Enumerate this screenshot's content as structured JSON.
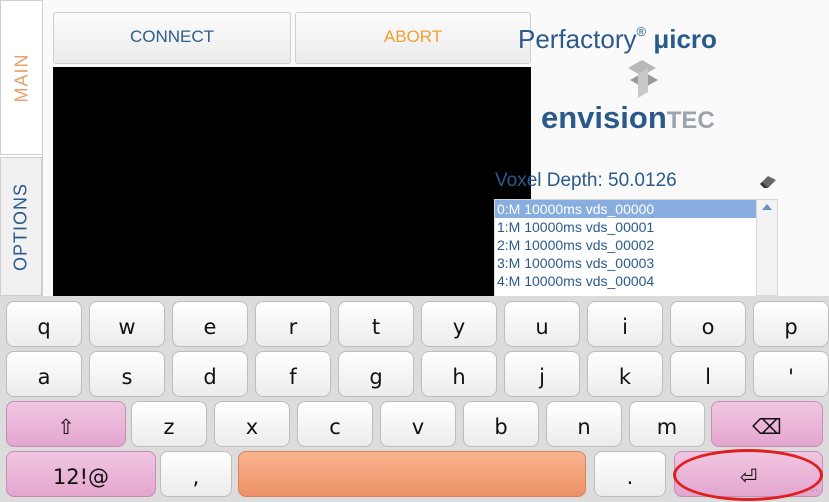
{
  "tabs": {
    "main": "MAIN",
    "options": "OPTIONS"
  },
  "toolbar": {
    "connect_label": "CONNECT",
    "abort_label": "ABORT"
  },
  "logo": {
    "product": "Perfactory",
    "registered": "®",
    "micro": "μicro",
    "brand_main": "envision",
    "brand_tec": "TEC"
  },
  "status": {
    "voxel_depth_label": "Voxel Depth: 50.0126"
  },
  "slices": [
    {
      "label": "0:M 10000ms vds_00000",
      "selected": true
    },
    {
      "label": "1:M 10000ms vds_00001",
      "selected": false
    },
    {
      "label": "2:M 10000ms vds_00002",
      "selected": false
    },
    {
      "label": "3:M 10000ms vds_00003",
      "selected": false
    },
    {
      "label": "4:M 10000ms vds_00004",
      "selected": false
    }
  ],
  "keyboard": {
    "row1": [
      "q",
      "w",
      "e",
      "r",
      "t",
      "y",
      "u",
      "i",
      "o",
      "p"
    ],
    "row2": [
      "a",
      "s",
      "d",
      "f",
      "g",
      "h",
      "j",
      "k",
      "l",
      "'"
    ],
    "row3": [
      "z",
      "x",
      "c",
      "v",
      "b",
      "n",
      "m"
    ],
    "shift": "⇧",
    "backspace": "⌫",
    "symbols": "12!@",
    "comma": ",",
    "period": ".",
    "enter": "⏎",
    "enter_dots": "..."
  },
  "colors": {
    "accent_blue": "#2a5a8c",
    "abort_orange": "#f0a030",
    "pink_key": "#e3a6cf",
    "space_key": "#ee9166",
    "highlight": "#e02020"
  }
}
